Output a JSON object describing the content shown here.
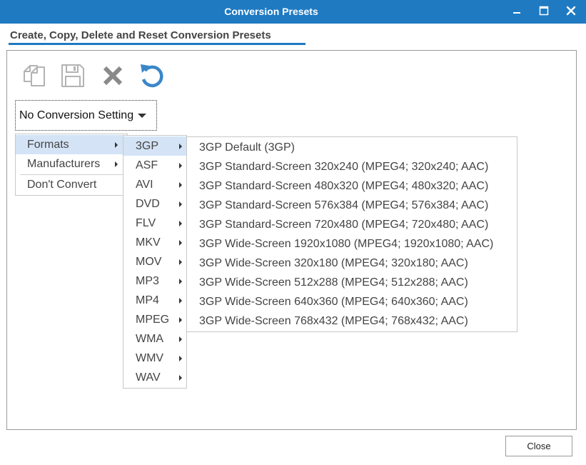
{
  "window": {
    "title": "Conversion Presets",
    "controls": {
      "minimize_icon": "minimize-icon",
      "maximize_icon": "maximize-icon",
      "close_icon": "close-icon"
    }
  },
  "section": {
    "heading": "Create, Copy, Delete and Reset Conversion Presets"
  },
  "toolbar": {
    "buttons": [
      {
        "name": "copy",
        "icon": "copy-icon"
      },
      {
        "name": "save",
        "icon": "save-icon"
      },
      {
        "name": "delete",
        "icon": "delete-icon"
      },
      {
        "name": "reset",
        "icon": "reset-icon"
      }
    ]
  },
  "dropdown": {
    "label": "No Conversion Setting"
  },
  "menu_level1": {
    "items": [
      {
        "label": "Formats",
        "has_submenu": true,
        "active": true
      },
      {
        "label": "Manufacturers",
        "has_submenu": true
      },
      {
        "label": "Don't Convert",
        "has_submenu": false
      }
    ]
  },
  "menu_level2": {
    "items": [
      {
        "label": "3GP",
        "active": true
      },
      {
        "label": "ASF"
      },
      {
        "label": "AVI"
      },
      {
        "label": "DVD"
      },
      {
        "label": "FLV"
      },
      {
        "label": "MKV"
      },
      {
        "label": "MOV"
      },
      {
        "label": "MP3"
      },
      {
        "label": "MP4"
      },
      {
        "label": "MPEG"
      },
      {
        "label": "WMA"
      },
      {
        "label": "WMV"
      },
      {
        "label": "WAV"
      }
    ]
  },
  "menu_level3": {
    "items": [
      "3GP Default (3GP)",
      "3GP Standard-Screen 320x240 (MPEG4; 320x240; AAC)",
      "3GP Standard-Screen 480x320 (MPEG4; 480x320; AAC)",
      "3GP Standard-Screen 576x384 (MPEG4; 576x384; AAC)",
      "3GP Standard-Screen 720x480 (MPEG4; 720x480; AAC)",
      "3GP Wide-Screen 1920x1080 (MPEG4; 1920x1080; AAC)",
      "3GP Wide-Screen 320x180 (MPEG4; 320x180; AAC)",
      "3GP Wide-Screen 512x288 (MPEG4; 512x288; AAC)",
      "3GP Wide-Screen 640x360 (MPEG4; 640x360; AAC)",
      "3GP Wide-Screen 768x432 (MPEG4; 768x432; AAC)"
    ]
  },
  "footer": {
    "close_label": "Close"
  },
  "colors": {
    "accent": "#1f7ac2",
    "menu_highlight": "#d4e4f6",
    "reset_icon": "#3a87c8"
  }
}
